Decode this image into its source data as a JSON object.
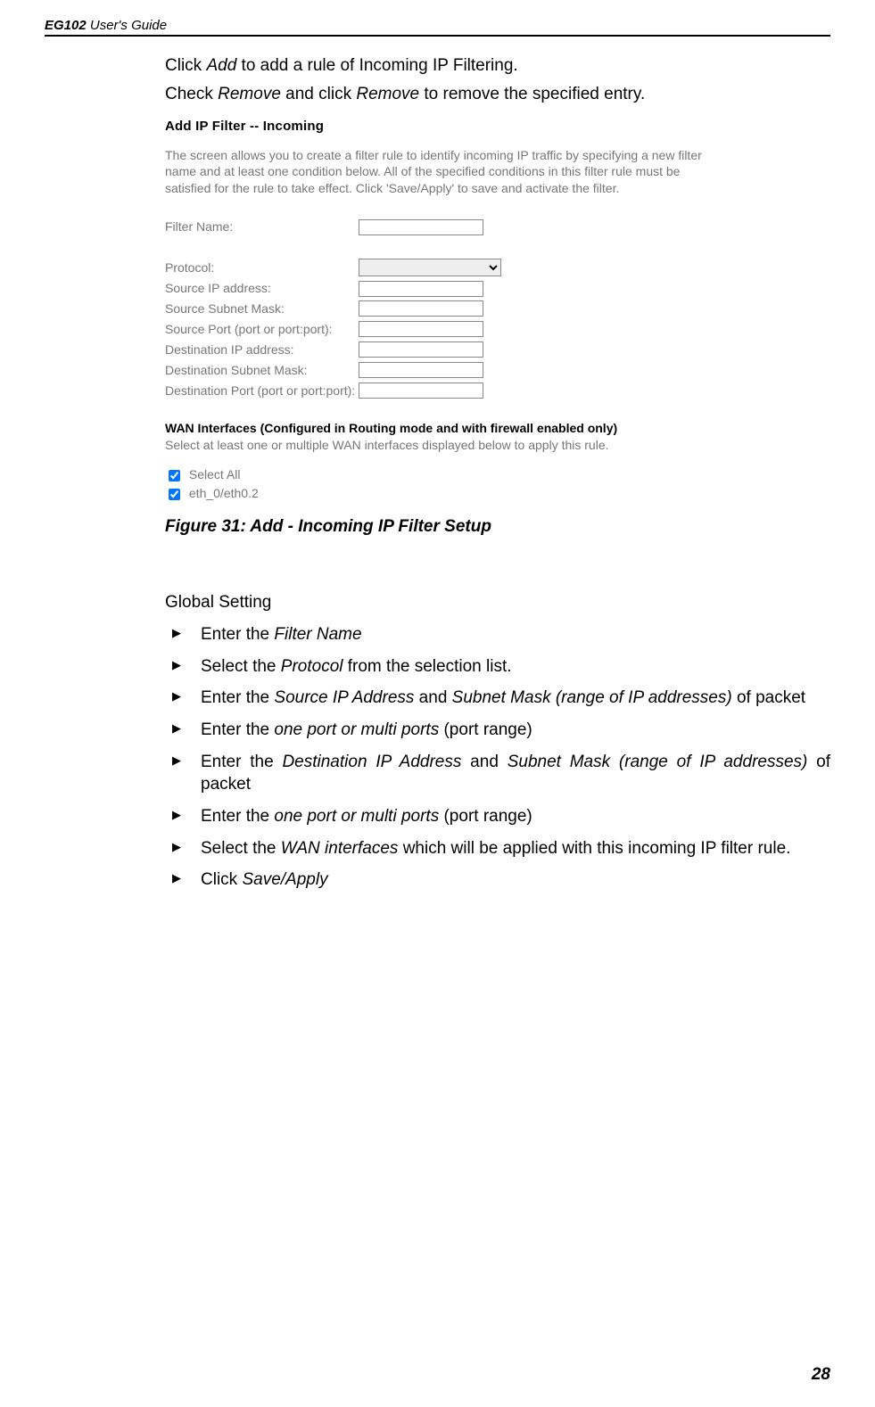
{
  "header": {
    "product": "EG102",
    "subtitle": " User's Guide"
  },
  "intro": {
    "click_pre": "Click ",
    "click_ital": "Add",
    "click_post": " to add a rule of Incoming IP Filtering.",
    "remove_pre": "Check ",
    "remove_ital1": "Remove",
    "remove_mid": " and click ",
    "remove_ital2": "Remove",
    "remove_post": " to remove the specified entry."
  },
  "shot": {
    "title": "Add IP Filter -- Incoming",
    "desc": "The screen allows you to create a filter rule to identify incoming IP traffic by specifying a new filter name and at least one condition below. All of the specified conditions in this filter rule must be satisfied for the rule to take effect. Click 'Save/Apply' to save and activate the filter.",
    "fields": {
      "filter_name": "Filter Name:",
      "protocol": "Protocol:",
      "src_ip": "Source IP address:",
      "src_mask": "Source Subnet Mask:",
      "src_port": "Source Port (port or port:port):",
      "dst_ip": "Destination IP address:",
      "dst_mask": "Destination Subnet Mask:",
      "dst_port": "Destination Port (port or port:port):"
    },
    "wan": {
      "title": "WAN Interfaces (Configured in Routing mode and with firewall enabled only)",
      "sub": "Select at least one or multiple WAN interfaces displayed below to apply this rule.",
      "select_all": "Select All",
      "iface": "eth_0/eth0.2"
    }
  },
  "caption": "Figure 31: Add - Incoming IP Filter Setup",
  "global": {
    "heading": "Global Setting",
    "items": [
      {
        "pre": "Enter the ",
        "ital": "Filter Name",
        "post": ""
      },
      {
        "pre": "Select the ",
        "ital": "Protocol",
        "post": " from the selection list."
      },
      {
        "pre": "Enter the ",
        "ital": "Source IP Address",
        "mid": " and ",
        "ital2": "Subnet Mask (range of IP addresses)",
        "post": " of packet"
      },
      {
        "pre": "Enter the ",
        "ital": "one port or multi ports",
        "post": " (port range)"
      },
      {
        "pre": "Enter the ",
        "ital": "Destination IP Address",
        "mid": " and ",
        "ital2": "Subnet Mask (range of IP addresses)",
        "post": " of packet"
      },
      {
        "pre": "Enter the ",
        "ital": "one port or multi ports",
        "post": " (port range)"
      },
      {
        "pre": "Select the ",
        "ital": "WAN interfaces",
        "post": " which will be applied with this incoming IP filter rule."
      },
      {
        "pre": "Click ",
        "ital": "Save/Apply",
        "post": ""
      }
    ]
  },
  "page_number": "28"
}
